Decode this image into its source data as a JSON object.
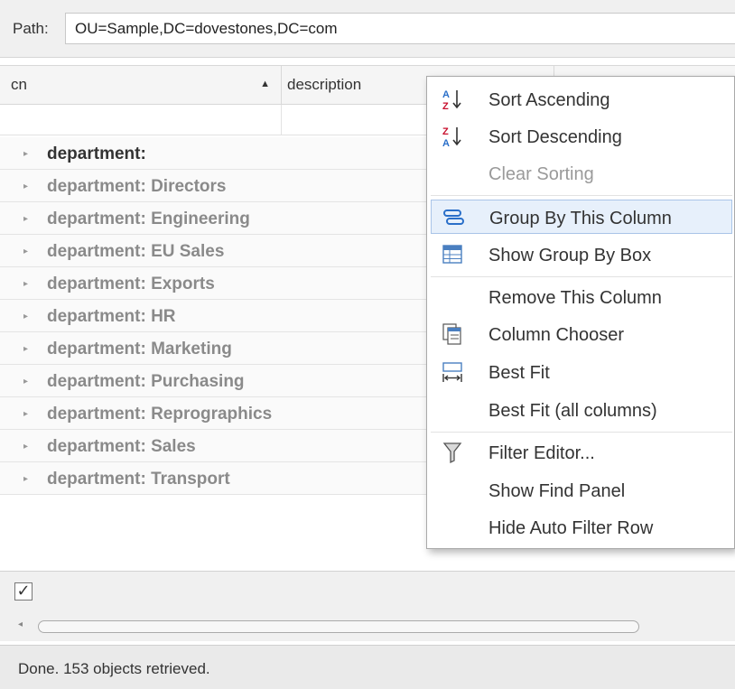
{
  "path": {
    "label": "Path:",
    "value": "OU=Sample,DC=dovestones,DC=com"
  },
  "grid": {
    "columns": [
      {
        "label": "cn",
        "sort": "▲"
      },
      {
        "label": "description"
      },
      {
        "label": ""
      }
    ],
    "rows": [
      {
        "expander": "▸",
        "label": "department:"
      },
      {
        "expander": "▸",
        "label": "department: Directors"
      },
      {
        "expander": "▸",
        "label": "department: Engineering"
      },
      {
        "expander": "▸",
        "label": "department: EU Sales"
      },
      {
        "expander": "▸",
        "label": "department: Exports"
      },
      {
        "expander": "▸",
        "label": "department: HR"
      },
      {
        "expander": "▸",
        "label": "department: Marketing"
      },
      {
        "expander": "▸",
        "label": "department: Purchasing"
      },
      {
        "expander": "▸",
        "label": "department: Reprographics"
      },
      {
        "expander": "▸",
        "label": "department: Sales"
      },
      {
        "expander": "▸",
        "label": "department: Transport"
      }
    ]
  },
  "menu": {
    "items": [
      {
        "label": "Sort Ascending",
        "icon": "sort-ascending-icon"
      },
      {
        "label": "Sort Descending",
        "icon": "sort-descending-icon"
      },
      {
        "label": "Clear Sorting",
        "disabled": true
      },
      {
        "label": "Group By This Column",
        "icon": "group-by-icon",
        "highlighted": true
      },
      {
        "label": "Show Group By Box",
        "icon": "group-box-icon"
      },
      {
        "label": "Remove This Column"
      },
      {
        "label": "Column Chooser",
        "icon": "column-chooser-icon"
      },
      {
        "label": "Best Fit",
        "icon": "best-fit-icon"
      },
      {
        "label": "Best Fit (all columns)"
      },
      {
        "label": "Filter Editor...",
        "icon": "filter-icon"
      },
      {
        "label": "Show Find Panel"
      },
      {
        "label": "Hide Auto Filter Row"
      }
    ]
  },
  "footer": {
    "checkbox_mark": "✓"
  },
  "scroll": {
    "left_arrow": "◂"
  },
  "status": {
    "text": "Done. 153 objects retrieved."
  },
  "colors": {
    "highlight": "#e7f0fb",
    "highlight_border": "#a9c4e8",
    "accent_icon": "#2a6fc9",
    "red_icon": "#c8102e"
  }
}
